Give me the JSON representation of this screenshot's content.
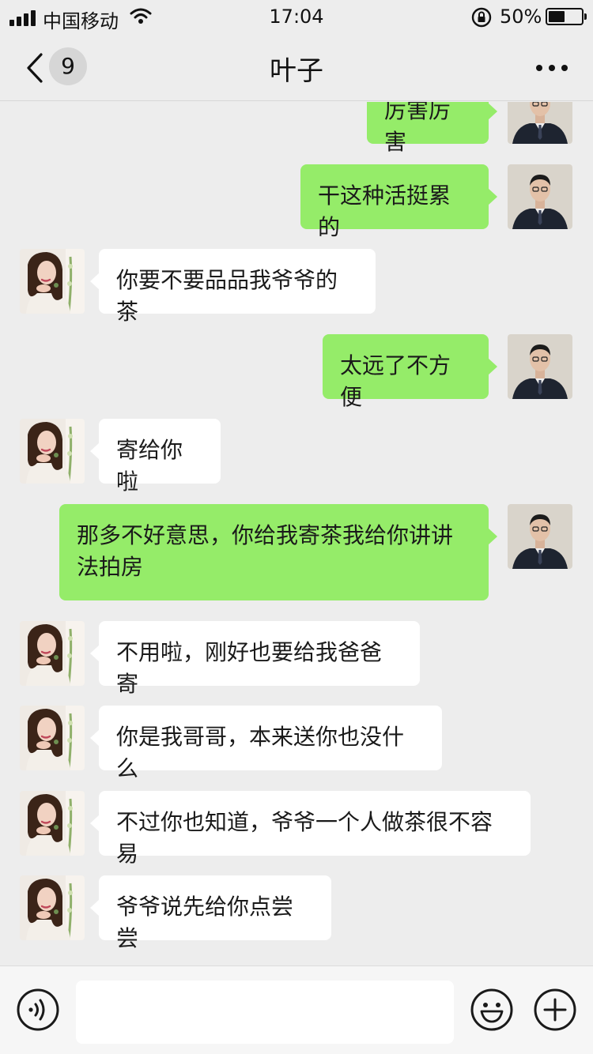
{
  "status_bar": {
    "carrier": "中国移动",
    "time": "17:04",
    "battery_percent": "50%",
    "battery_level": 0.5
  },
  "nav": {
    "unread_count": "9",
    "title": "叶子"
  },
  "colors": {
    "background": "#ededed",
    "outgoing_bubble": "#95ec69",
    "incoming_bubble": "#ffffff"
  },
  "messages": [
    {
      "side": "out",
      "text": "厉害厉害"
    },
    {
      "side": "out",
      "text": "干这种活挺累的"
    },
    {
      "side": "in",
      "text": "你要不要品品我爷爷的茶"
    },
    {
      "side": "out",
      "text": "太远了不方便"
    },
    {
      "side": "in",
      "text": "寄给你啦"
    },
    {
      "side": "out",
      "text": "那多不好意思，你给我寄茶我给你讲讲法拍房"
    },
    {
      "side": "in",
      "text": "不用啦，刚好也要给我爸爸寄"
    },
    {
      "side": "in",
      "text": "你是我哥哥，本来送你也没什么"
    },
    {
      "side": "in",
      "text": "不过你也知道，爷爷一个人做茶很不容易"
    },
    {
      "side": "in",
      "text": "爷爷说先给你点尝尝"
    }
  ],
  "input_bar": {
    "voice_icon": "voice-icon",
    "emoji_icon": "emoji-icon",
    "plus_icon": "plus-icon",
    "text_value": ""
  }
}
